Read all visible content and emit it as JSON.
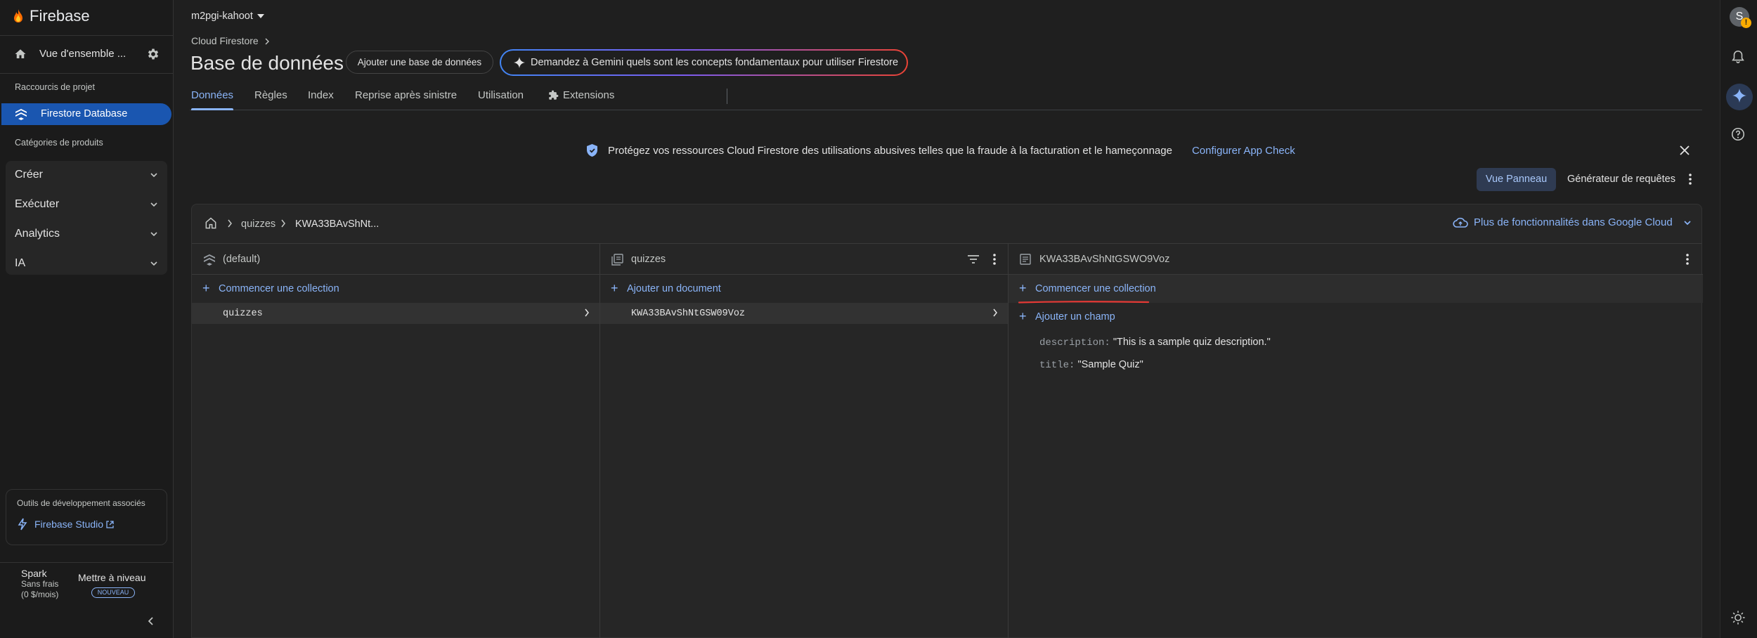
{
  "colors": {
    "accent": "#8ab4f8",
    "active_nav": "#1a56b0",
    "annotation": "#e53935"
  },
  "sidebar": {
    "brand": "Firebase",
    "overview": "Vue d'ensemble ...",
    "shortcuts_title": "Raccourcis de projet",
    "active_item": "Firestore Database",
    "categories_title": "Catégories de produits",
    "categories": [
      {
        "label": "Créer"
      },
      {
        "label": "Exécuter"
      },
      {
        "label": "Analytics"
      },
      {
        "label": "IA"
      }
    ],
    "tools_title": "Outils de développement associés",
    "studio": "Firebase Studio",
    "plan": {
      "name": "Spark",
      "line1": "Sans frais",
      "line2": "(0 $/mois)"
    },
    "upgrade": "Mettre à niveau",
    "badge": "NOUVEAU"
  },
  "header": {
    "project": "m2pgi-kahoot",
    "breadcrumb": "Cloud Firestore",
    "title": "Base de données",
    "add_db": "Ajouter une base de données",
    "gemini": "Demandez à Gemini quels sont les concepts fondamentaux pour utiliser Firestore"
  },
  "tabs": [
    {
      "label": "Données"
    },
    {
      "label": "Règles"
    },
    {
      "label": "Index"
    },
    {
      "label": "Reprise après sinistre"
    },
    {
      "label": "Utilisation"
    },
    {
      "label": "Extensions"
    }
  ],
  "banner": {
    "text": "Protégez vos ressources Cloud Firestore des utilisations abusives telles que la fraude à la facturation et le hameçonnage",
    "link": "Configurer App Check"
  },
  "view": {
    "panel": "Vue Panneau",
    "query": "Générateur de requêtes"
  },
  "path": {
    "collection": "quizzes",
    "document": "KWA33BAvShNt..."
  },
  "google_cloud": "Plus de fonctionnalités dans Google Cloud",
  "columns": {
    "root": {
      "title": "(default)",
      "add": "Commencer une collection",
      "item": "quizzes"
    },
    "collection": {
      "title": "quizzes",
      "add": "Ajouter un document",
      "item": "KWA33BAvShNtGSW09Voz"
    },
    "document": {
      "title": "KWA33BAvShNtGSWO9Voz",
      "add_collection": "Commencer une collection",
      "add_field": "Ajouter un champ",
      "fields": [
        {
          "key": "description:",
          "value": "\"This is a sample quiz description.\""
        },
        {
          "key": "title:",
          "value": "\"Sample Quiz\""
        }
      ]
    }
  },
  "rail": {
    "avatar": "S",
    "warning": "!"
  }
}
